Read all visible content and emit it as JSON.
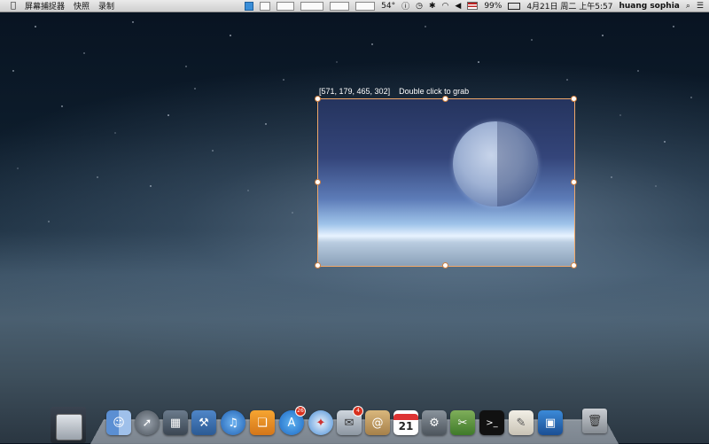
{
  "menubar": {
    "apple_icon": "apple-icon",
    "items": [
      "屏幕捕捉器",
      "快照",
      "录制"
    ],
    "status": {
      "temperature": "54°",
      "battery_percent": "99%",
      "datetime": "4月21日 周二 上午5:57",
      "user": "huang sophia"
    }
  },
  "selection": {
    "info": "[571, 179, 465, 302]",
    "hint": "Double click to grab"
  },
  "dock": {
    "calendar_day": "21",
    "appstore_badge": "26",
    "mail_badge": "4"
  },
  "colors": {
    "selection_border": "#f0a86a",
    "badge": "#d8301e"
  }
}
